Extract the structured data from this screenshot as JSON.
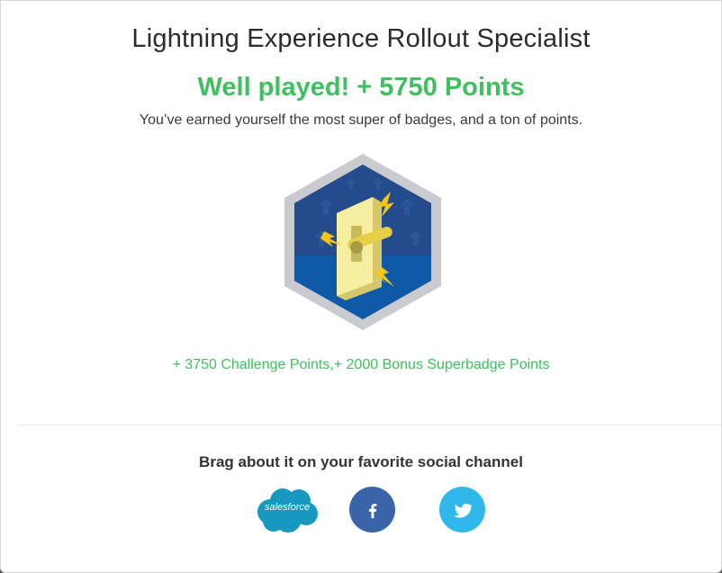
{
  "modal": {
    "badge_title": "Lightning Experience Rollout Specialist",
    "points_headline": "Well played! + 5750 Points",
    "subtitle": "You’ve earned yourself the most super of badges, and a ton of points.",
    "breakdown": "+ 3750 Challenge Points,+ 2000 Bonus Superbadge Points",
    "brag_heading": "Brag about it on your favorite social channel"
  },
  "social": {
    "salesforce_label": "salesforce",
    "facebook_icon": "facebook-icon",
    "twitter_icon": "twitter-icon"
  },
  "colors": {
    "accent_green": "#3fbf5f",
    "facebook_blue": "#3b64a8",
    "twitter_blue": "#30b8ea",
    "salesforce_blue": "#1798c1",
    "badge_navy": "#1d3f7a"
  }
}
